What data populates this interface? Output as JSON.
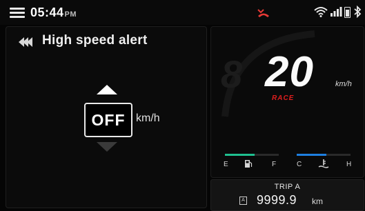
{
  "status": {
    "time": "05:44",
    "ampm": "PM",
    "icons": [
      "menu-icon",
      "missed-call-icon",
      "wifi-icon",
      "signal-icon",
      "battery-icon",
      "bluetooth-icon"
    ],
    "call_color": "#e53935"
  },
  "setting": {
    "title": "High speed alert",
    "value": "OFF",
    "unit": "km/h"
  },
  "dashboard": {
    "speed": "20",
    "speed_unit": "km/h",
    "mode": "RACE",
    "mode_color": "#e01e1e",
    "fuel": {
      "empty_label": "E",
      "full_label": "F",
      "level": 0.55,
      "color": "#1fbf8f"
    },
    "temp": {
      "cold_label": "C",
      "hot_label": "H",
      "level": 0.55,
      "color": "#1e7fe0"
    }
  },
  "trip": {
    "label": "TRIP A",
    "badge": "A",
    "value": "9999.9",
    "unit": "km"
  }
}
